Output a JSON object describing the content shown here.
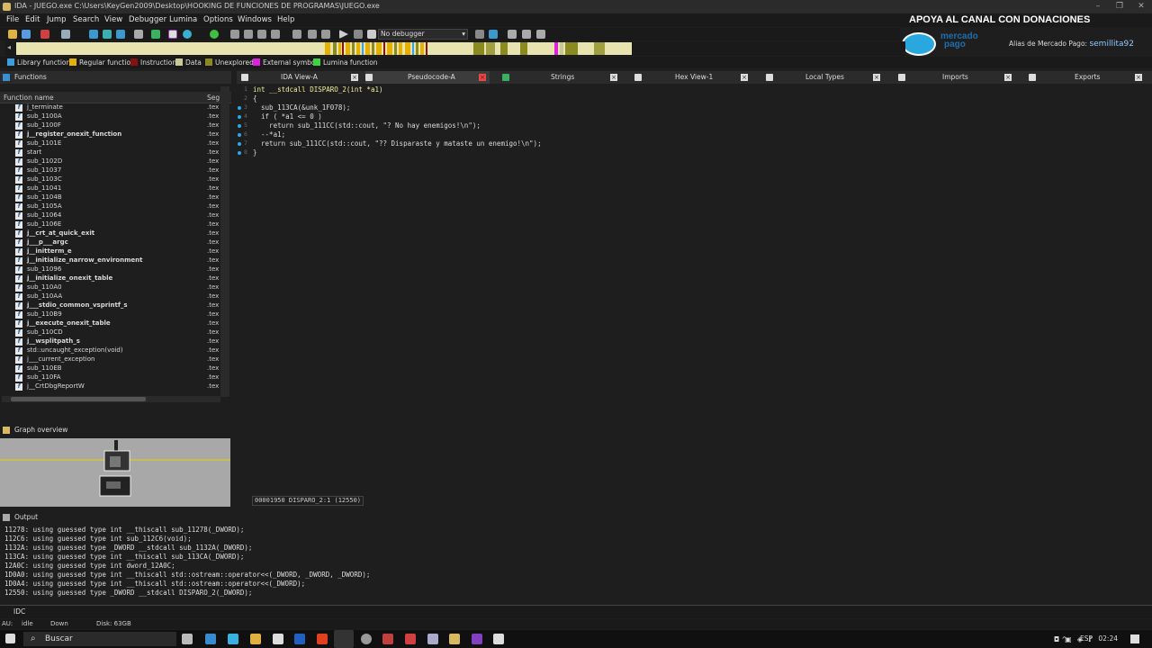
{
  "titlebar": {
    "title": "IDA - JUEGO.exe C:\\Users\\KeyGen2009\\Desktop\\HOOKING DE FUNCIONES DE PROGRAMAS\\JUEGO.exe",
    "minimize": "–",
    "maximize": "❐",
    "close": "✕"
  },
  "menu": [
    "File",
    "Edit",
    "Jump",
    "Search",
    "View",
    "Debugger",
    "Lumina",
    "Options",
    "Windows",
    "Help"
  ],
  "promo": {
    "headline": "APOYA AL CANAL CON DONACIONES",
    "mp_line1": "mercado",
    "mp_line2": "pago",
    "alias_label": "Alias de Mercado Pago:",
    "alias_value": "semillita92"
  },
  "toolbar": {
    "debugger_select": "No debugger"
  },
  "legend": [
    {
      "label": "Library function",
      "color": "#3aa0e0"
    },
    {
      "label": "Regular function",
      "color": "#e6b000"
    },
    {
      "label": "Instruction",
      "color": "#8a1010"
    },
    {
      "label": "Data",
      "color": "#c8c898"
    },
    {
      "label": "Unexplored",
      "color": "#8a8a20"
    },
    {
      "label": "External symbol",
      "color": "#e020e0"
    },
    {
      "label": "Lumina function",
      "color": "#40d040"
    }
  ],
  "functions_panel": {
    "title": "Functions",
    "col_name": "Function name",
    "col_seg": "Seg",
    "rows": [
      {
        "name": "j_terminate",
        "seg": ".tex",
        "bold": false
      },
      {
        "name": "sub_1100A",
        "seg": ".tex",
        "bold": false
      },
      {
        "name": "sub_1100F",
        "seg": ".tex",
        "bold": false
      },
      {
        "name": "j__register_onexit_function",
        "seg": ".tex",
        "bold": true
      },
      {
        "name": "sub_1101E",
        "seg": ".tex",
        "bold": false
      },
      {
        "name": "start",
        "seg": ".tex",
        "bold": false
      },
      {
        "name": "sub_1102D",
        "seg": ".tex",
        "bold": false
      },
      {
        "name": "sub_11037",
        "seg": ".tex",
        "bold": false
      },
      {
        "name": "sub_1103C",
        "seg": ".tex",
        "bold": false
      },
      {
        "name": "sub_11041",
        "seg": ".tex",
        "bold": false
      },
      {
        "name": "sub_1104B",
        "seg": ".tex",
        "bold": false
      },
      {
        "name": "sub_1105A",
        "seg": ".tex",
        "bold": false
      },
      {
        "name": "sub_11064",
        "seg": ".tex",
        "bold": false
      },
      {
        "name": "sub_1106E",
        "seg": ".tex",
        "bold": false
      },
      {
        "name": "j__crt_at_quick_exit",
        "seg": ".tex",
        "bold": true
      },
      {
        "name": "j___p___argc",
        "seg": ".tex",
        "bold": true
      },
      {
        "name": "j__initterm_e",
        "seg": ".tex",
        "bold": true
      },
      {
        "name": "j__initialize_narrow_environment",
        "seg": ".tex",
        "bold": true
      },
      {
        "name": "sub_11096",
        "seg": ".tex",
        "bold": false
      },
      {
        "name": "j__initialize_onexit_table",
        "seg": ".tex",
        "bold": true
      },
      {
        "name": "sub_110A0",
        "seg": ".tex",
        "bold": false
      },
      {
        "name": "sub_110AA",
        "seg": ".tex",
        "bold": false
      },
      {
        "name": "j___stdio_common_vsprintf_s",
        "seg": ".tex",
        "bold": true
      },
      {
        "name": "sub_110B9",
        "seg": ".tex",
        "bold": false
      },
      {
        "name": "j__execute_onexit_table",
        "seg": ".tex",
        "bold": true
      },
      {
        "name": "sub_110CD",
        "seg": ".tex",
        "bold": false
      },
      {
        "name": "j__wsplitpath_s",
        "seg": ".tex",
        "bold": true
      },
      {
        "name": "std::uncaught_exception(void)",
        "seg": ".tex",
        "bold": false
      },
      {
        "name": "j___current_exception",
        "seg": ".tex",
        "bold": false
      },
      {
        "name": "sub_110EB",
        "seg": ".tex",
        "bold": false
      },
      {
        "name": "sub_110FA",
        "seg": ".tex",
        "bold": false
      },
      {
        "name": "j__CrtDbgReportW",
        "seg": ".tex",
        "bold": false
      }
    ]
  },
  "graph_panel": {
    "title": "Graph overview"
  },
  "tabs": [
    {
      "label": "IDA View-A",
      "active": false
    },
    {
      "label": "Pseudocode-A",
      "active": true
    },
    {
      "label": "Strings",
      "active": false
    },
    {
      "label": "Hex View-1",
      "active": false
    },
    {
      "label": "Local Types",
      "active": false
    },
    {
      "label": "Imports",
      "active": false
    },
    {
      "label": "Exports",
      "active": false
    }
  ],
  "pseudocode": [
    {
      "n": "1",
      "dot": false,
      "text": "int __stdcall DISPARO_2(int *a1)"
    },
    {
      "n": "2",
      "dot": false,
      "text": "{"
    },
    {
      "n": "3",
      "dot": true,
      "text": "  sub_113CA(&unk_1F078);"
    },
    {
      "n": "4",
      "dot": true,
      "text": "  if ( *a1 <= 0 )"
    },
    {
      "n": "5",
      "dot": true,
      "text": "    return sub_111CC(std::cout, \"? No hay enemigos!\\n\");"
    },
    {
      "n": "6",
      "dot": true,
      "text": "  --*a1;"
    },
    {
      "n": "7",
      "dot": true,
      "text": "  return sub_111CC(std::cout, \"?? Disparaste y mataste un enemigo!\\n\");"
    },
    {
      "n": "8",
      "dot": true,
      "text": "}"
    }
  ],
  "code_status": "00001950 DISPARO_2:1 (12550)",
  "output": {
    "title": "Output",
    "lines": [
      "11278: using guessed type int __thiscall sub_11278(_DWORD);",
      "112C6: using guessed type int sub_112C6(void);",
      "1132A: using guessed type _DWORD __stdcall sub_1132A(_DWORD);",
      "113CA: using guessed type int __thiscall sub_113CA(_DWORD);",
      "12A0C: using guessed type int dword_12A0C;",
      "1D0A0: using guessed type int __thiscall std::ostream::operator<<(_DWORD, _DWORD, _DWORD);",
      "1D0A4: using guessed type int __thiscall std::ostream::operator<<(_DWORD);",
      "12550: using guessed type _DWORD __stdcall DISPARO_2(_DWORD);"
    ]
  },
  "idc_label": "IDC",
  "status": {
    "au": "AU:",
    "state": "idle",
    "dir": "Down",
    "disk": "Disk: 63GB"
  },
  "taskbar": {
    "search": "Buscar",
    "lang": "ESP",
    "time": "02:24"
  }
}
